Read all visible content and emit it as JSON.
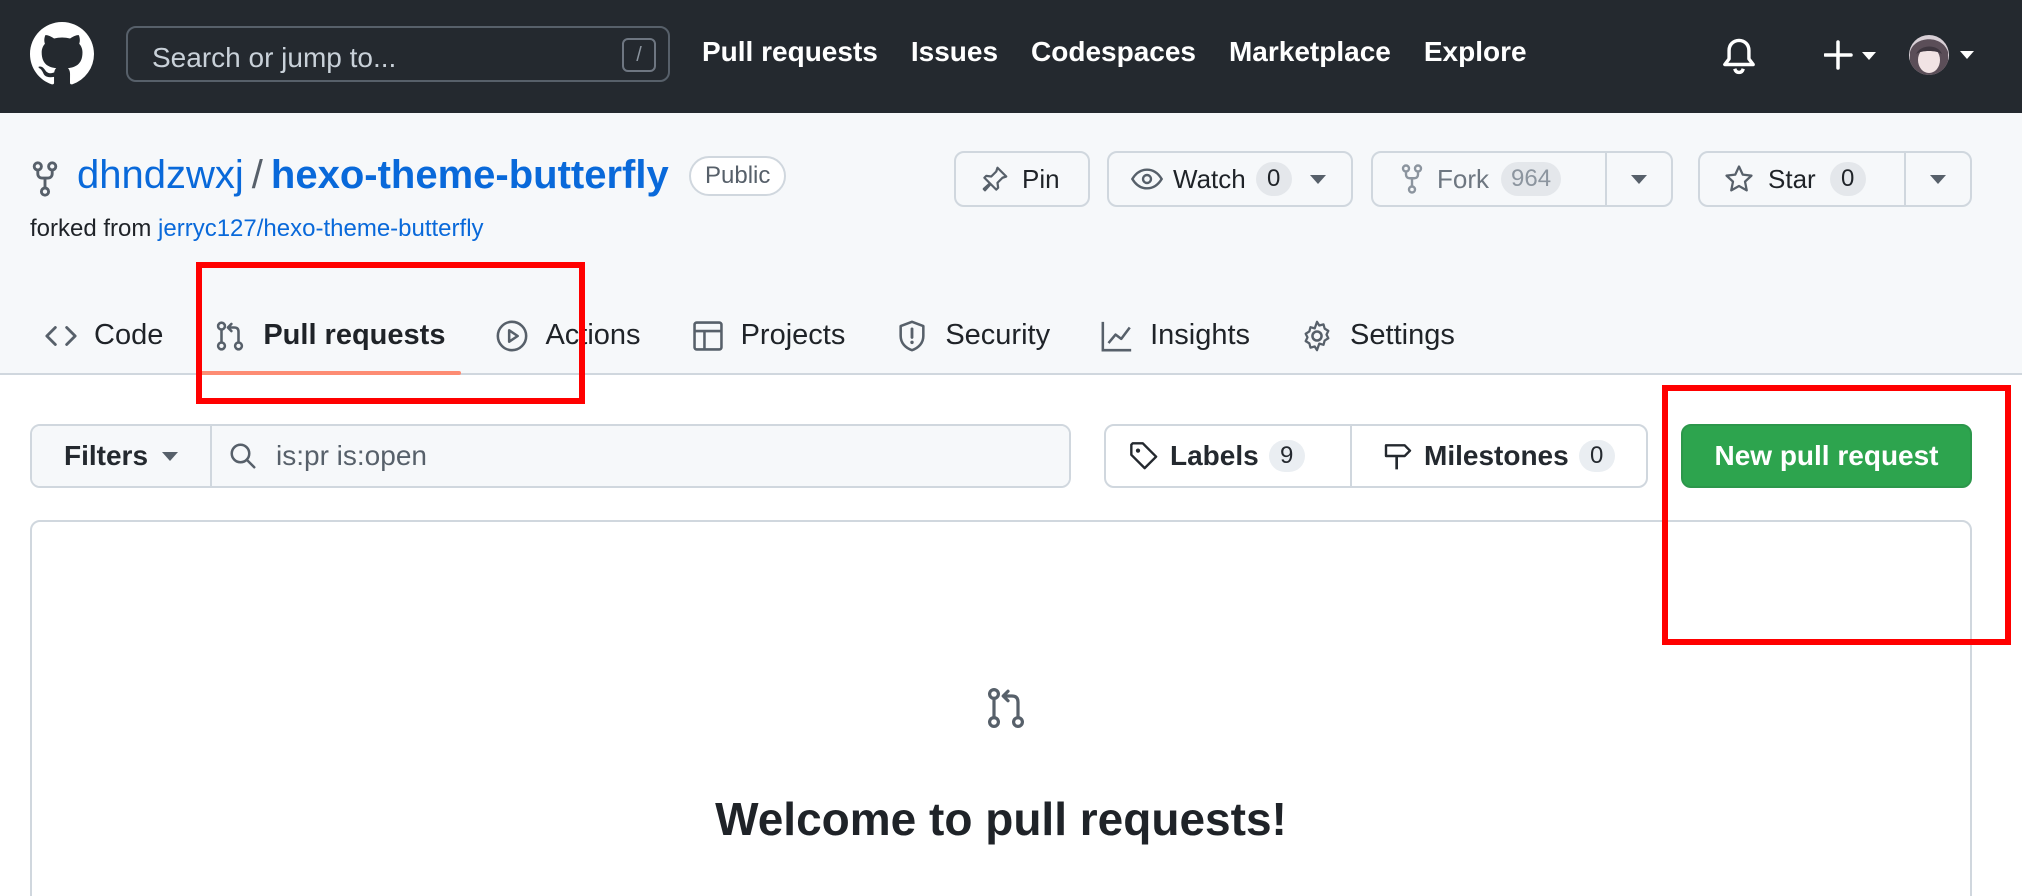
{
  "header": {
    "search_placeholder": "Search or jump to...",
    "search_shortcut": "/",
    "nav": [
      "Pull requests",
      "Issues",
      "Codespaces",
      "Marketplace",
      "Explore"
    ],
    "icons": [
      "github-logo-icon",
      "bell-icon",
      "plus-icon",
      "avatar"
    ]
  },
  "repo": {
    "owner": "dhndzwxj",
    "separator": "/",
    "name": "hexo-theme-butterfly",
    "visibility": "Public",
    "forked_prefix": "forked from",
    "forked_from": "jerryc127/hexo-theme-butterfly",
    "actions": {
      "pin": "Pin",
      "watch": "Watch",
      "watch_count": "0",
      "fork": "Fork",
      "fork_count": "964",
      "star": "Star",
      "star_count": "0"
    }
  },
  "tabs": [
    {
      "label": "Code",
      "icon": "code-icon"
    },
    {
      "label": "Pull requests",
      "icon": "git-pull-request-icon",
      "active": true
    },
    {
      "label": "Actions",
      "icon": "play-icon"
    },
    {
      "label": "Projects",
      "icon": "table-icon"
    },
    {
      "label": "Security",
      "icon": "shield-icon"
    },
    {
      "label": "Insights",
      "icon": "graph-icon"
    },
    {
      "label": "Settings",
      "icon": "gear-icon"
    }
  ],
  "subnav": {
    "filters_label": "Filters",
    "query": "is:pr is:open",
    "labels_label": "Labels",
    "labels_count": "9",
    "milestones_label": "Milestones",
    "milestones_count": "0",
    "new_pr_label": "New pull request"
  },
  "blankslate": {
    "title": "Welcome to pull requests!"
  },
  "colors": {
    "header_bg": "#24292f",
    "link": "#0969da",
    "primary_button": "#2da44e",
    "active_tab_underline": "#fd8c73",
    "annotation": "#ff0000"
  }
}
